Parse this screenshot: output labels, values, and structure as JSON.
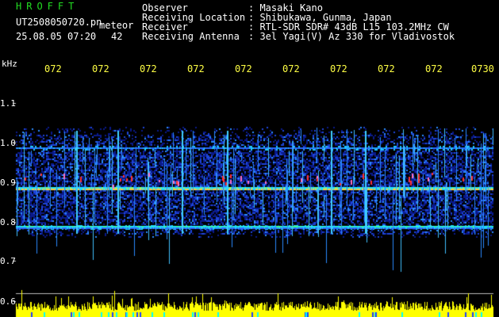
{
  "header": {
    "app_name": "HROFFT",
    "filename": "UT2508050720.pn",
    "meteor_label": "meteor",
    "datetime": "25.08.05 07:20",
    "count": "42",
    "fields": [
      {
        "label": "Observer",
        "value": ": Masaki Kano"
      },
      {
        "label": "Receiving Location",
        "value": ": Shibukawa, Gunma, Japan"
      },
      {
        "label": "Receiver",
        "value": ": RTL-SDR SDR# 43dB L15 103.2MHz CW"
      },
      {
        "label": "Receiving Antenna",
        "value": ": 3el Yagi(V) Az 330 for Vladivostok"
      }
    ]
  },
  "y_axis": {
    "unit": "kHz",
    "ticks": [
      "1.1",
      "1.0",
      "0.9",
      "0.8",
      "0.7",
      "0.6"
    ]
  },
  "time_axis": {
    "ticks": [
      "072",
      "072",
      "072",
      "072",
      "072",
      "072",
      "072",
      "072",
      "072",
      "0730"
    ]
  },
  "colors": {
    "background": "#000000",
    "title": "#22dd22",
    "time_ticks": "#ffff44",
    "noise_low": "#0a1a8a",
    "noise_mid": "#2a6aff",
    "signal": "#20e0ff",
    "peak": "#ff3030",
    "level_bars": "#ffff00"
  }
}
